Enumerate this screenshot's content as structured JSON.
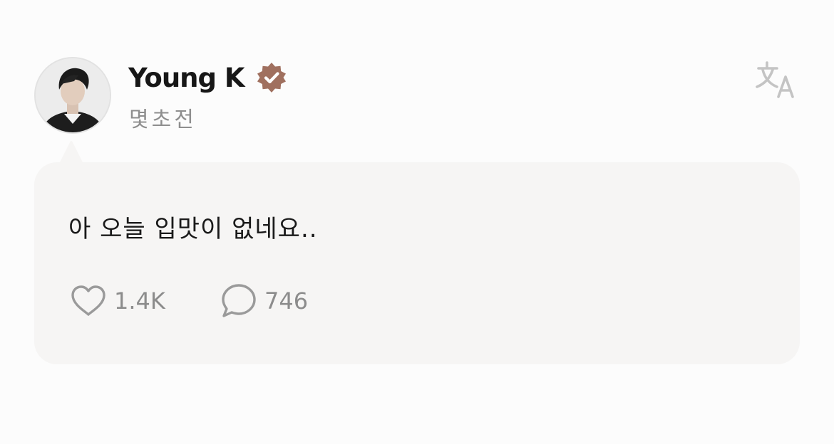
{
  "post": {
    "author": {
      "name": "Young K",
      "verified": true,
      "verified_badge_color": "#a0705f",
      "avatar_icon": "profile-photo"
    },
    "timestamp": "몇초전",
    "translate_icon": "translate-icon",
    "text": "아 오늘 입맛이 없네요..",
    "likes": {
      "icon": "heart-icon",
      "count": "1.4K"
    },
    "comments": {
      "icon": "comment-icon",
      "count": "746"
    }
  },
  "colors": {
    "background": "#fcfcfc",
    "bubble": "#f6f5f4",
    "text_primary": "#171717",
    "text_secondary": "#8e8e8e",
    "icon_gray": "#c4c4c4"
  }
}
